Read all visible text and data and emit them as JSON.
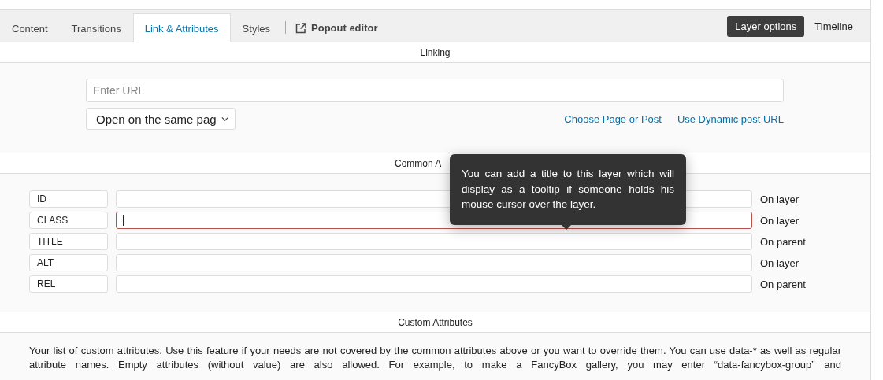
{
  "tabs": [
    {
      "label": "Content",
      "selected": false
    },
    {
      "label": "Transitions",
      "selected": false
    },
    {
      "label": "Link & Attributes",
      "selected": true
    },
    {
      "label": "Styles",
      "selected": false
    }
  ],
  "popout": {
    "label": "Popout editor"
  },
  "view_buttons": [
    {
      "label": "Layer options",
      "selected": true
    },
    {
      "label": "Timeline",
      "selected": false
    }
  ],
  "linking": {
    "heading": "Linking",
    "url_field": {
      "placeholder": "Enter URL"
    },
    "target_select": {
      "value": "Open on the same pag"
    },
    "links": [
      "Choose Page or Post",
      "Use Dynamic post URL"
    ]
  },
  "common_attributes": {
    "heading": "Common A",
    "rows": [
      {
        "label": "ID",
        "applies_to": "On layer",
        "focused": false
      },
      {
        "label": "CLASS",
        "applies_to": "On layer",
        "focused": true
      },
      {
        "label": "TITLE",
        "applies_to": "On parent",
        "focused": false
      },
      {
        "label": "ALT",
        "applies_to": "On layer",
        "focused": false
      },
      {
        "label": "REL",
        "applies_to": "On parent",
        "focused": false
      }
    ]
  },
  "tooltip": {
    "text": "You can add a title to this layer which will display as a tooltip if someone holds his mouse cursor over the layer."
  },
  "custom_attributes": {
    "heading": "Custom Attributes",
    "description": "Your list of custom attributes. Use this feature if your needs are not covered by the common attributes above or you want to override them. You can use data-* as well as regular attribute names. Empty attributes (without value) are also allowed. For example, to make a FancyBox gallery, you may enter “data-fancybox-group” and"
  }
}
